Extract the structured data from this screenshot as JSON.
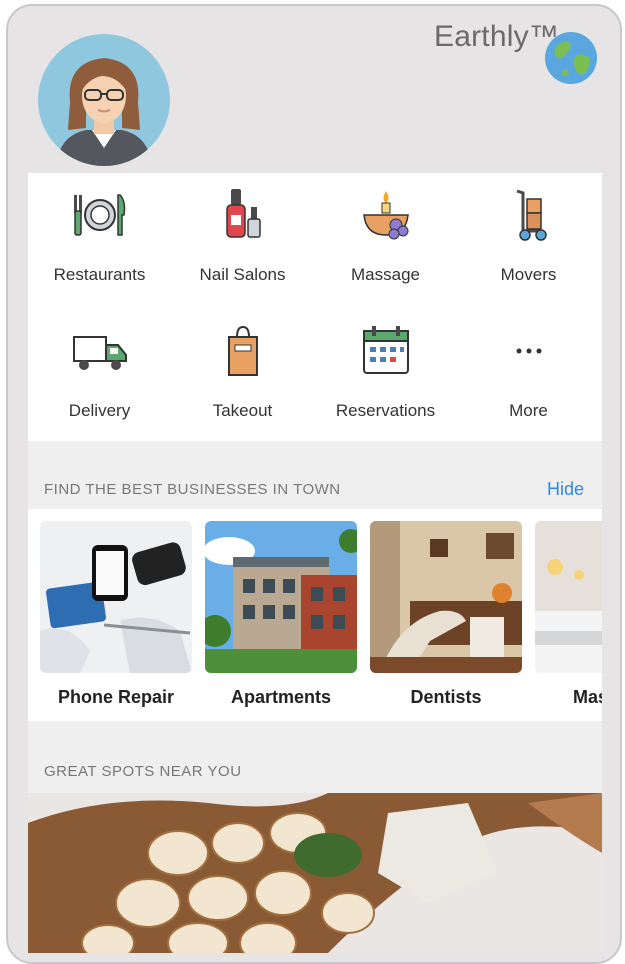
{
  "app": {
    "brand": "Earthly™"
  },
  "categories": [
    {
      "label": "Restaurants",
      "icon": "fork-knife-plate-icon"
    },
    {
      "label": "Nail Salons",
      "icon": "nail-polish-icon"
    },
    {
      "label": "Massage",
      "icon": "candle-stones-icon"
    },
    {
      "label": "Movers",
      "icon": "hand-truck-icon"
    },
    {
      "label": "Delivery",
      "icon": "delivery-truck-icon"
    },
    {
      "label": "Takeout",
      "icon": "takeout-bag-icon"
    },
    {
      "label": "Reservations",
      "icon": "calendar-icon"
    },
    {
      "label": "More",
      "icon": "more-dots-icon"
    }
  ],
  "find_section": {
    "heading": "FIND THE BEST BUSINESSES IN TOWN",
    "hide_label": "Hide",
    "businesses": [
      {
        "name": "Phone Repair"
      },
      {
        "name": "Apartments"
      },
      {
        "name": "Dentists"
      },
      {
        "name": "Massage"
      }
    ]
  },
  "spots_section": {
    "heading": "GREAT SPOTS NEAR YOU"
  },
  "colors": {
    "accent": "#2b8ae8",
    "background": "#e6e4e5"
  }
}
